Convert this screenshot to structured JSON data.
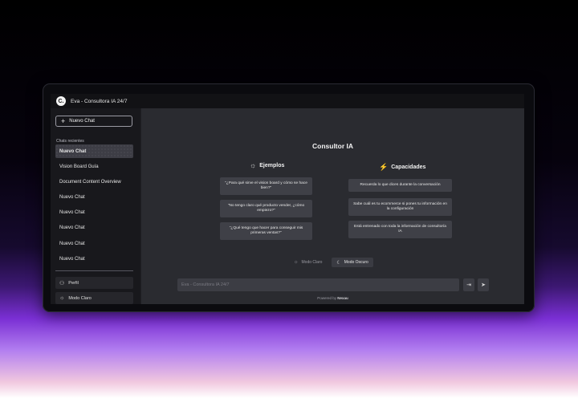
{
  "app": {
    "logo_text": "C.",
    "title": "Eva - Consultora IA 24/7"
  },
  "sidebar": {
    "new_chat_label": "Nuevo Chat",
    "recent_label": "Chats recientes",
    "chats": [
      "Nuevo Chat",
      "Vision Board Guía",
      "Document Content Overview",
      "Nuevo Chat",
      "Nuevo Chat",
      "Nuevo Chat",
      "Nuevo Chat",
      "Nuevo Chat"
    ],
    "profile_label": "Perfil",
    "mode_label": "Modo Claro"
  },
  "main": {
    "title": "Consultor IA",
    "examples_heading": "Ejemplos",
    "examples": [
      "\"¿Para qué sirve el vision board y cómo se hace bien?\"",
      "\"No tengo claro qué producto vender, ¿cómo empiezo?\"",
      "\"¿Qué tengo que hacer para conseguir mis primeras ventas?\""
    ],
    "capabilities_heading": "Capacidades",
    "capabilities": [
      "Recuerda lo que dices durante la conversación",
      "Sabe cuál es tu ecommerce si pones tu información en la configuración",
      "Está entrenado con toda la información de consultoría IA"
    ],
    "mode_light": "Modo Claro",
    "mode_dark": "Modo Oscuro",
    "input_placeholder": "Eva - Consultora IA 24/7",
    "powered_prefix": "Powered by",
    "powered_brand": "Nexau"
  },
  "icons": {
    "sun": "☼",
    "moon": "☾",
    "bolt": "⚡",
    "user": "⚇",
    "send": "➤",
    "attach": "⇥"
  },
  "colors": {
    "sidebar_bg": "#18181c",
    "main_bg": "#2a2b30",
    "card_bg": "#3f4047"
  }
}
